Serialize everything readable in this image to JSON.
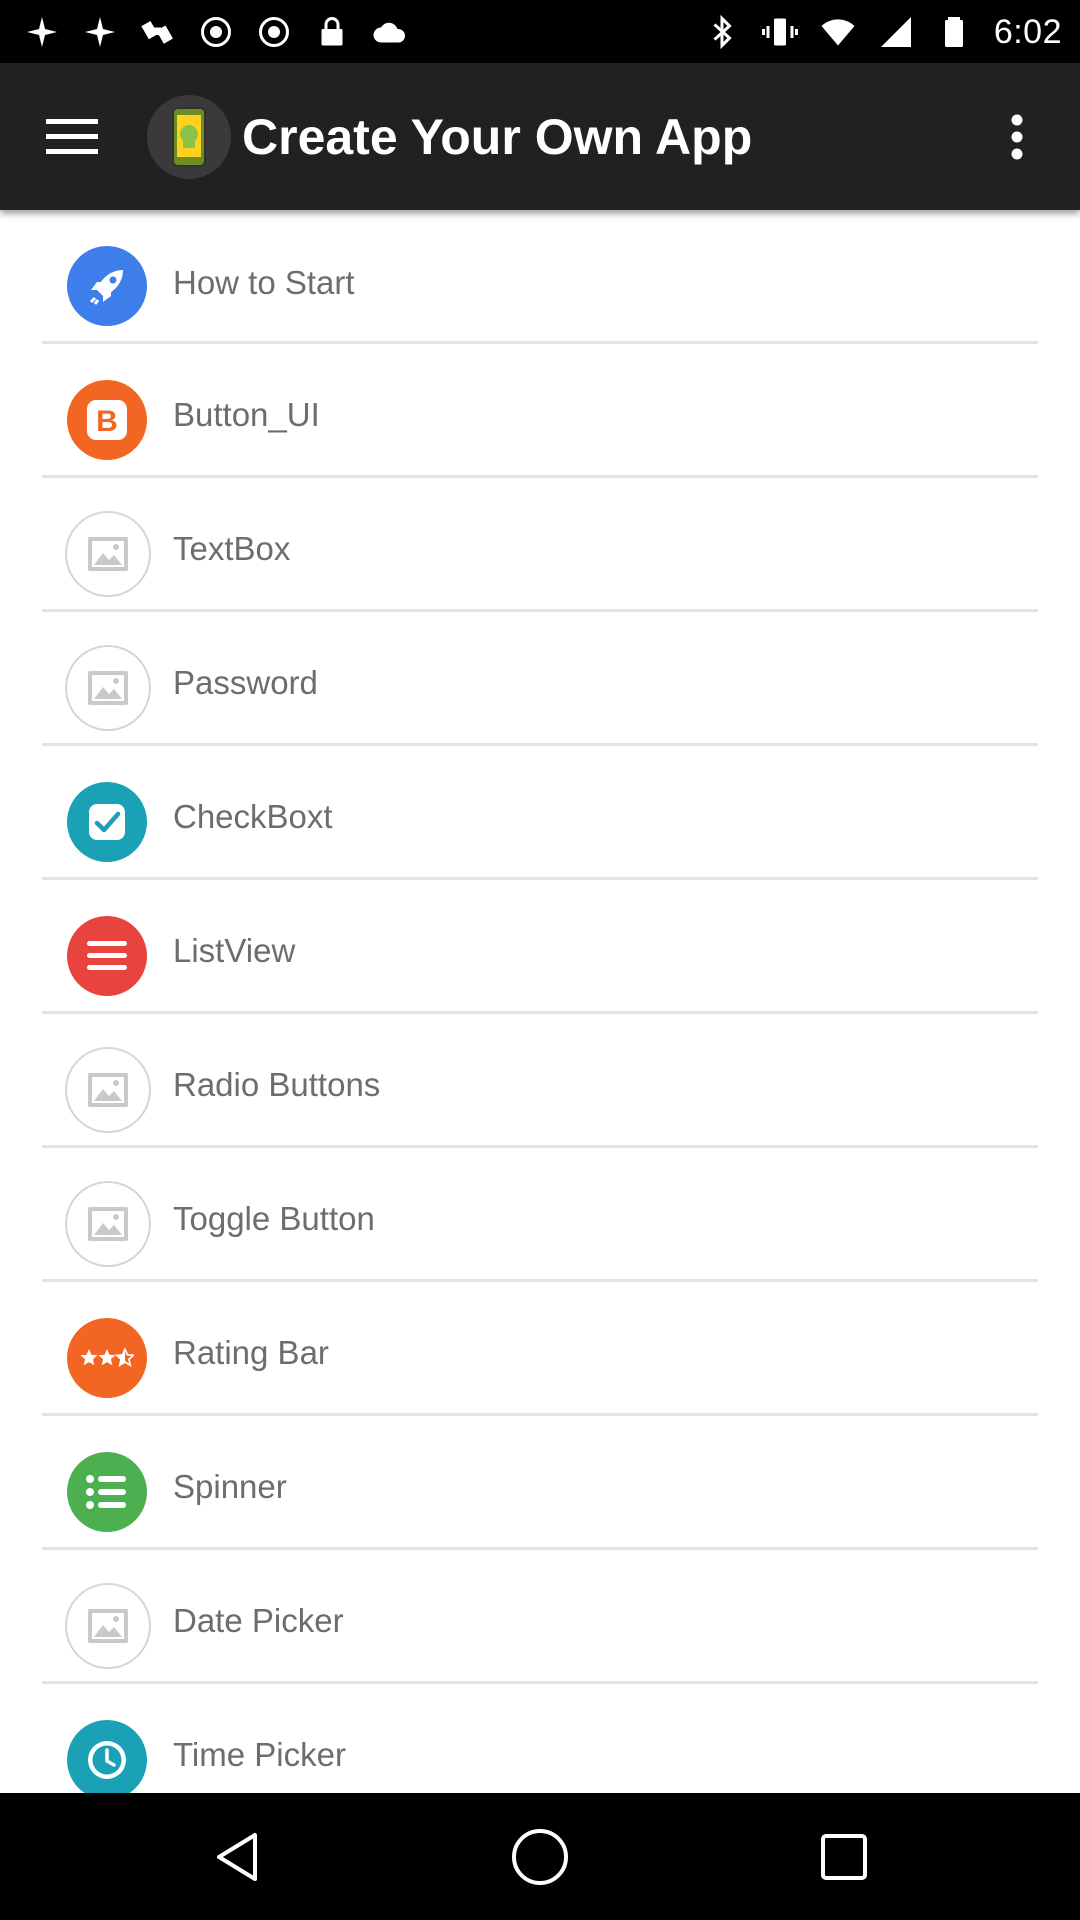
{
  "status_bar": {
    "time": "6:02",
    "left_icons": [
      "photos-icon",
      "photos-icon",
      "fake-gps-icon",
      "satellite-icon",
      "email-icon",
      "alarm-icon",
      "lock-icon",
      "cloud-icon"
    ],
    "right_icons": [
      "bluetooth-icon",
      "vibrate-icon",
      "wifi-icon",
      "signal-icon",
      "battery-icon"
    ]
  },
  "app_bar": {
    "title": "Create Your Own App",
    "menu_icon": "hamburger-menu-icon",
    "overflow_icon": "more-vert-icon"
  },
  "list": {
    "items": [
      {
        "label": "How to Start",
        "icon": "rocket-icon",
        "color": "#3D7EEA"
      },
      {
        "label": "Button_UI",
        "icon": "letter-b-icon",
        "color": "#F26522"
      },
      {
        "label": "TextBox",
        "icon": "image-placeholder-icon",
        "color": "#CCCCCC"
      },
      {
        "label": "Password",
        "icon": "image-placeholder-icon",
        "color": "#CCCCCC"
      },
      {
        "label": "CheckBoxt",
        "icon": "checkbox-icon",
        "color": "#1BA1B5"
      },
      {
        "label": "ListView",
        "icon": "list-lines-icon",
        "color": "#E8433E"
      },
      {
        "label": "Radio Buttons",
        "icon": "image-placeholder-icon",
        "color": "#CCCCCC"
      },
      {
        "label": "Toggle Button",
        "icon": "image-placeholder-icon",
        "color": "#CCCCCC"
      },
      {
        "label": "Rating Bar",
        "icon": "stars-icon",
        "color": "#F26522"
      },
      {
        "label": "Spinner",
        "icon": "bulleted-list-icon",
        "color": "#4CAF50"
      },
      {
        "label": "Date Picker",
        "icon": "image-placeholder-icon",
        "color": "#CCCCCC"
      },
      {
        "label": "Time Picker",
        "icon": "clock-icon",
        "color": "#1BA1B5"
      }
    ]
  },
  "nav_bar": {
    "back_icon": "back-triangle-icon",
    "home_icon": "home-circle-icon",
    "recents_icon": "recents-square-icon"
  }
}
